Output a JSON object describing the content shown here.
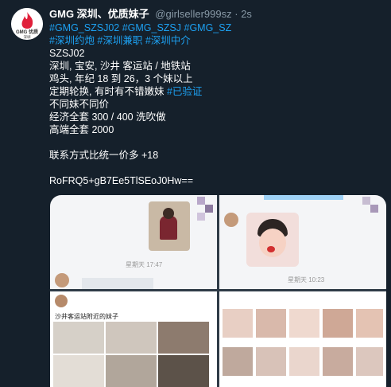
{
  "header": {
    "display_name": "GMG 深圳、优质妹子",
    "handle": "@girlseller999sz",
    "separator": "·",
    "time": "2s"
  },
  "avatar": {
    "label": "GMG 优质",
    "sublabel": "深圳",
    "icon": "flame-icon",
    "color": "#e0203a"
  },
  "tweet": {
    "hashtags_line1": "#GMG_SZSJ02 #GMG_SZSJ #GMG_SZ",
    "hashtags_line2": "#深圳约炮 #深圳兼职 #深圳中介",
    "code": "SZSJ02",
    "area": "深圳, 宝安, 沙井 客运站 / 地铁站",
    "detail": "鸡头, 年纪 18 到 26，3 个妹以上",
    "rotation_text": "定期轮换, 有时有不错嫩妹",
    "verified_tag": "#已验证",
    "price_note": "不同妹不同价",
    "economy": "经济全套 300 / 400 洗吹做",
    "premium": "高端全套 2000",
    "contact": "联系方式比统一价多 +18",
    "encoded": "RoFRQ5+gB7Ee5TlSEoJ0Hw=="
  },
  "media": {
    "tile1_time": "星期天 17:47",
    "tile2_time": "星期天 10:23",
    "tile3_caption": "沙井客运站附近的妹子"
  }
}
